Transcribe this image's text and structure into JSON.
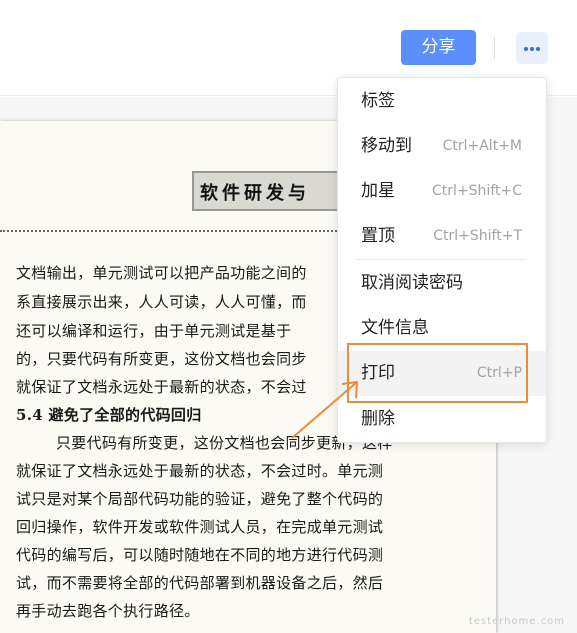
{
  "toolbar": {
    "share_label": "分享",
    "more_icon": "more-horizontal-icon",
    "accent": "#5b8ff9"
  },
  "document": {
    "header_title": "软件研发与",
    "lines": [
      "文档输出，单元测试可以把产品功能之间的",
      "系直接展示出来，人人可读，人人可懂，而",
      "还可以编译和运行，由于单元测试是基于",
      "的，只要代码有所变更，这份文档也会同步",
      "就保证了文档永远处于最新的状态，不会过"
    ],
    "section_heading": "5.4   避免了全部的代码回归",
    "paragraph": [
      "只要代码有所变更，这份文档也会同步更新，这样",
      "就保证了文档永远处于最新的状态，不会过时。单元测",
      "试只是对某个局部代码功能的验证，避免了整个代码的",
      "回归操作，软件开发或软件测试人员，在完成单元测试",
      "代码的编写后，可以随时随地在不同的地方进行代码测",
      "试，而不需要将全部的代码部署到机器设备之后，然后",
      "再手动去跑各个执行路径。"
    ],
    "watermark": "testerhome.com"
  },
  "menu": {
    "items": [
      {
        "label": "标签",
        "shortcut": ""
      },
      {
        "label": "移动到",
        "shortcut": "Ctrl+Alt+M"
      },
      {
        "label": "加星",
        "shortcut": "Ctrl+Shift+C"
      },
      {
        "label": "置顶",
        "shortcut": "Ctrl+Shift+T"
      },
      {
        "label": "取消阅读密码",
        "shortcut": ""
      },
      {
        "label": "文件信息",
        "shortcut": ""
      },
      {
        "label": "打印",
        "shortcut": "Ctrl+P"
      },
      {
        "label": "删除",
        "shortcut": ""
      }
    ],
    "highlighted_item": "打印"
  },
  "annotation": {
    "color": "#ef8a3a"
  }
}
